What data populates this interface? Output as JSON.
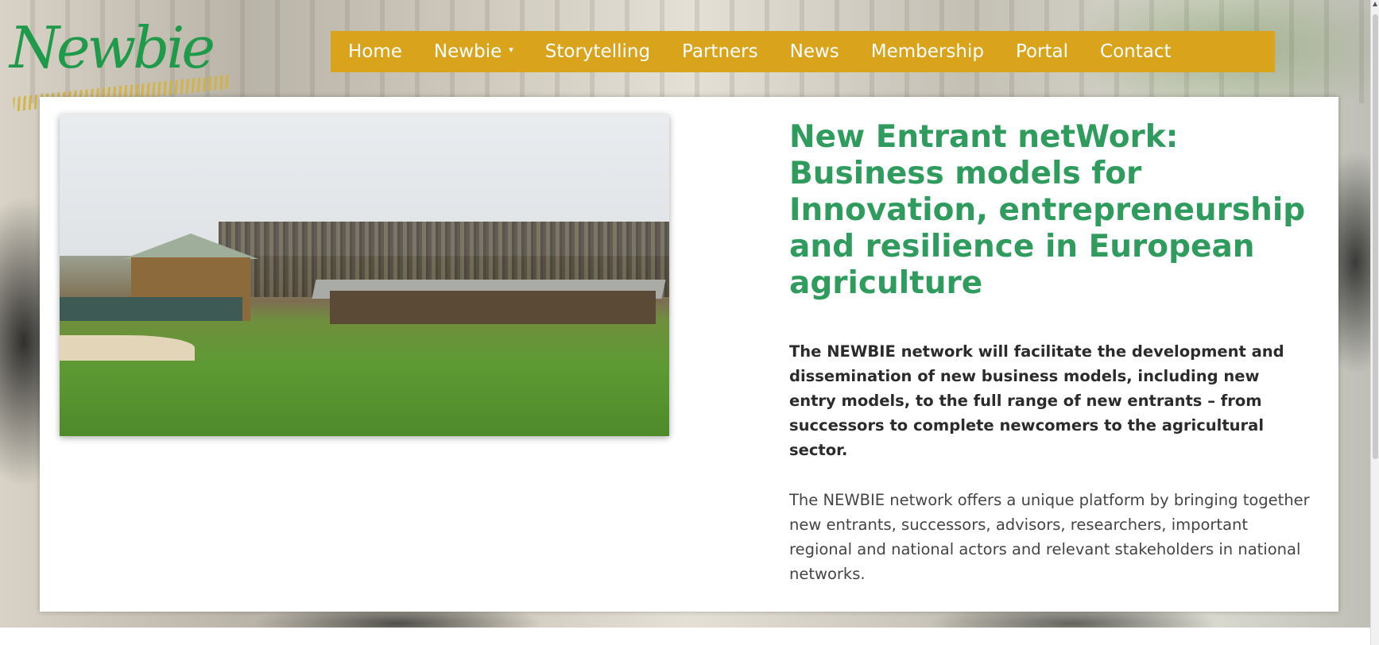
{
  "logo": {
    "text": "Newbie"
  },
  "nav": {
    "items": [
      {
        "label": "Home"
      },
      {
        "label": "Newbie",
        "caret": "▾"
      },
      {
        "label": "Storytelling"
      },
      {
        "label": "Partners"
      },
      {
        "label": "News"
      },
      {
        "label": "Membership"
      },
      {
        "label": "Portal"
      },
      {
        "label": "Contact"
      }
    ]
  },
  "main": {
    "heading": "New Entrant netWork: Business models for Innovation, entrepreneurship and resilience in European agriculture",
    "lead": "The NEWBIE network will facilitate the development and dissemination of new business models, including new entry models, to the full range of new entrants – from successors to complete newcomers to the agricultural sector.",
    "body": "The NEWBIE network offers a unique platform by bringing together new entrants, successors, advisors, researchers, important regional and national actors and relevant stakeholders in national networks."
  },
  "colors": {
    "nav_background": "#d9a41c",
    "heading": "#2f9c5e",
    "logo_green": "#1f9a4a",
    "logo_wheat": "#d4b23c"
  }
}
